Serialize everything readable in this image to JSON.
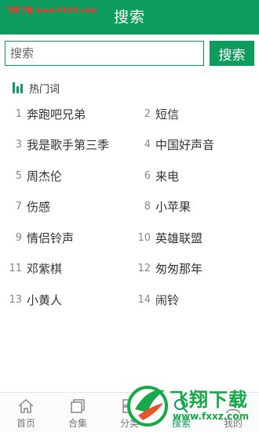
{
  "header": {
    "title": "搜索"
  },
  "watermark_top": "飞翔下载 www.FXXZ.com",
  "search": {
    "placeholder": "搜索",
    "value": "",
    "button_label": "搜索"
  },
  "hot_section": {
    "label": "热门词"
  },
  "hot_words": [
    [
      {
        "rank": "1",
        "word": "奔跑吧兄弟"
      },
      {
        "rank": "2",
        "word": "短信"
      }
    ],
    [
      {
        "rank": "3",
        "word": "我是歌手第三季"
      },
      {
        "rank": "4",
        "word": "中国好声音"
      }
    ],
    [
      {
        "rank": "5",
        "word": "周杰伦"
      },
      {
        "rank": "6",
        "word": "来电"
      }
    ],
    [
      {
        "rank": "7",
        "word": "伤感"
      },
      {
        "rank": "8",
        "word": "小苹果"
      }
    ],
    [
      {
        "rank": "9",
        "word": "情侣铃声"
      },
      {
        "rank": "10",
        "word": "英雄联盟"
      }
    ],
    [
      {
        "rank": "11",
        "word": "邓紫棋"
      },
      {
        "rank": "12",
        "word": "匆匆那年"
      }
    ],
    [
      {
        "rank": "13",
        "word": "小黄人"
      },
      {
        "rank": "14",
        "word": "闹铃"
      }
    ]
  ],
  "tabs": [
    {
      "label": "首页",
      "icon": "home-icon"
    },
    {
      "label": "合集",
      "icon": "collection-icon"
    },
    {
      "label": "分类",
      "icon": "category-icon"
    },
    {
      "label": "搜索",
      "icon": "search-icon"
    },
    {
      "label": "我的",
      "icon": "user-icon"
    }
  ],
  "watermark_br": {
    "text": "飞翔下载",
    "url": "www.fxxz.com"
  },
  "colors": {
    "brand": "#0e9c5e",
    "watermark_green": "#17a84a",
    "watermark_red": "#ff3030"
  }
}
